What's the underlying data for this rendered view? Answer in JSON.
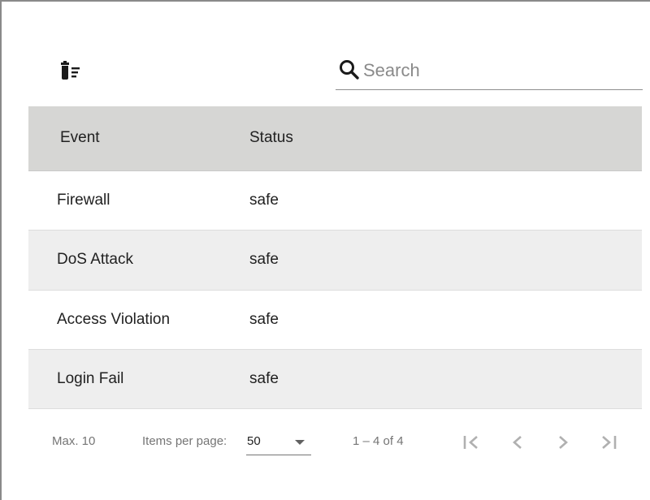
{
  "toolbar": {
    "delete_icon": "delete-sweep-icon",
    "search": {
      "placeholder": "Search",
      "value": "",
      "icon": "search-icon"
    }
  },
  "table": {
    "columns": [
      "Event",
      "Status"
    ],
    "rows": [
      {
        "event": "Firewall",
        "status": "safe"
      },
      {
        "event": "DoS Attack",
        "status": "safe"
      },
      {
        "event": "Access Violation",
        "status": "safe"
      },
      {
        "event": "Login Fail",
        "status": "safe"
      }
    ]
  },
  "paginator": {
    "max_label": "Max. 10",
    "items_per_page_label": "Items per page:",
    "page_size": "50",
    "range_label": "1 – 4 of 4",
    "first_icon": "first-page-icon",
    "prev_icon": "chevron-left-icon",
    "next_icon": "chevron-right-icon",
    "last_icon": "last-page-icon"
  },
  "colors": {
    "header_bg": "#d6d6d4",
    "stripe_bg": "#eeeeee",
    "text": "#212121",
    "muted": "#757575",
    "disabled_icon": "#b0b0b0"
  }
}
